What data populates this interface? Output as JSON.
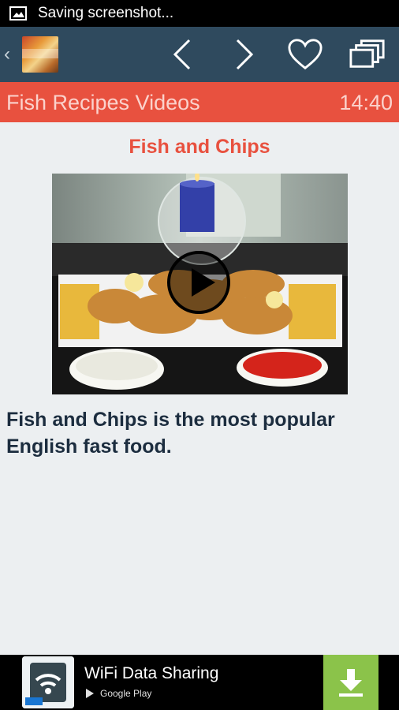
{
  "status_bar": {
    "notification": "Saving screenshot..."
  },
  "toolbar": {
    "back_icon": "chevron-left-icon",
    "app_icon": "app-thumbnail",
    "prev_icon": "chevron-left-icon",
    "next_icon": "chevron-right-icon",
    "favorite_icon": "heart-icon",
    "gallery_icon": "stacked-windows-icon"
  },
  "header": {
    "title": "Fish Recipes Videos",
    "time": "14:40",
    "color": "#e8513f"
  },
  "recipe": {
    "title": "Fish and Chips",
    "description": "Fish and Chips is the most popular English fast food.",
    "video_icon": "play-icon"
  },
  "ad": {
    "title": "WiFi Data Sharing",
    "store_label": "Google Play",
    "icon": "wifi-icon",
    "download_icon": "download-icon",
    "accent": "#8bc34a"
  }
}
